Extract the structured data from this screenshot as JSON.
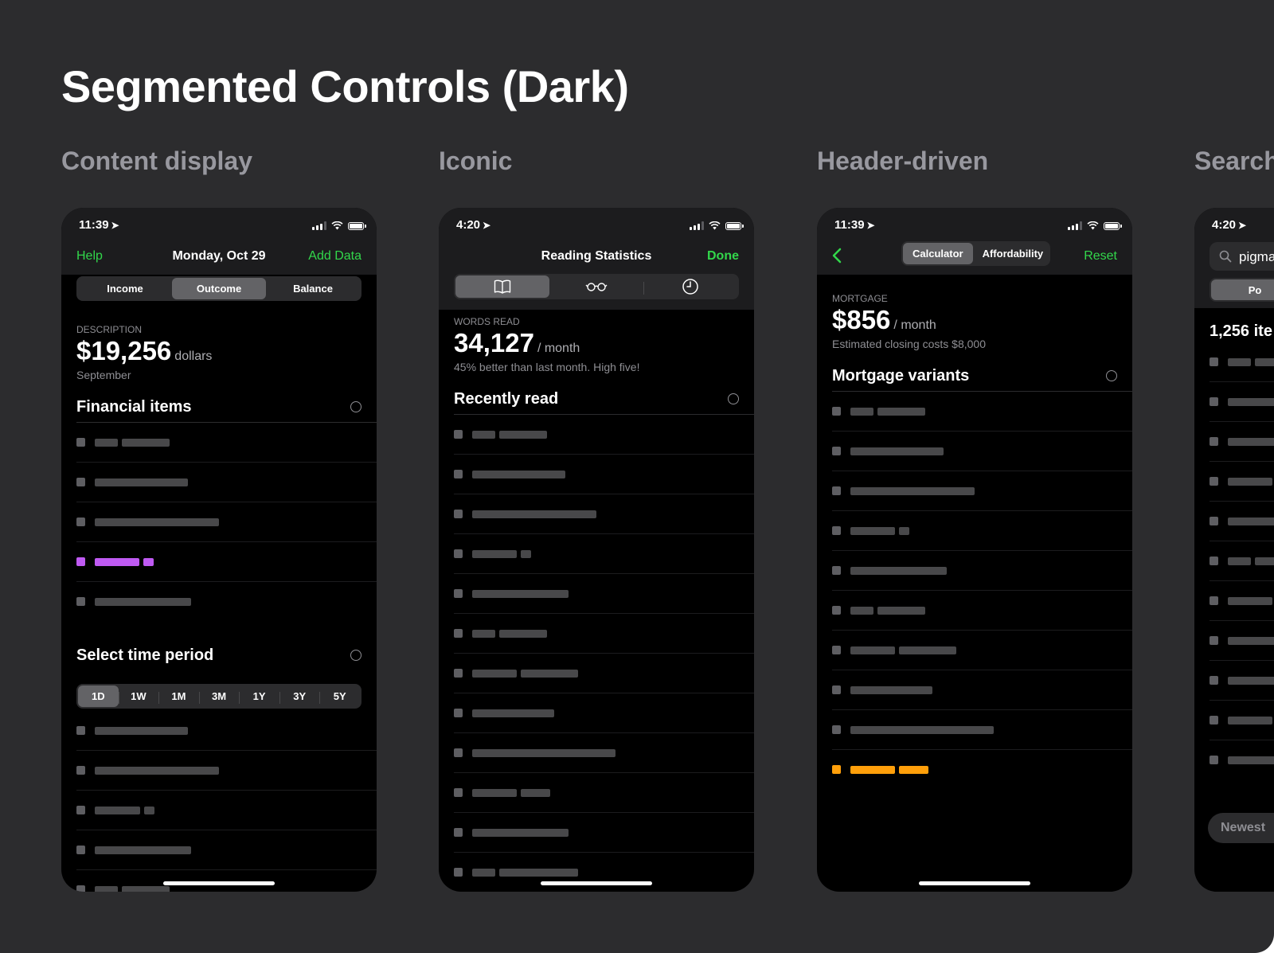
{
  "page": {
    "title": "Segmented Controls (Dark)"
  },
  "sections": [
    "Content display",
    "Iconic",
    "Header-driven",
    "Search"
  ],
  "phone1": {
    "time": "11:39",
    "nav": {
      "left": "Help",
      "title": "Monday, Oct 29",
      "right": "Add Data"
    },
    "segments": [
      "Income",
      "Outcome",
      "Balance"
    ],
    "selected_segment": "Outcome",
    "caption": "DESCRIPTION",
    "amount": "$19,256",
    "unit": "dollars",
    "sub": "September",
    "section1": "Financial items",
    "section2": "Select time period",
    "periods": [
      "1D",
      "1W",
      "1M",
      "3M",
      "1Y",
      "3Y",
      "5Y"
    ],
    "selected_period": "1D"
  },
  "phone2": {
    "time": "4:20",
    "nav": {
      "title": "Reading Statistics",
      "right": "Done"
    },
    "icon_segments": [
      "book-icon",
      "glasses-icon",
      "clock-icon"
    ],
    "selected_segment": "book-icon",
    "caption": "WORDS READ",
    "amount": "34,127",
    "unit": "/ month",
    "sub": "45% better than last month. High five!",
    "section1": "Recently read"
  },
  "phone3": {
    "time": "11:39",
    "segments": [
      "Calculator",
      "Affordability"
    ],
    "selected_segment": "Calculator",
    "nav": {
      "right": "Reset"
    },
    "caption": "MORTGAGE",
    "amount": "$856",
    "unit": "/ month",
    "sub": "Estimated closing costs $8,000",
    "section1": "Mortgage variants"
  },
  "phone4": {
    "time": "4:20",
    "search_value": "pigma",
    "segment_visible": "Po",
    "count_text": "1,256 ite",
    "sort_button": "Newest"
  },
  "colors": {
    "accent": "#32d74b",
    "highlight_purple": "#bf5af2",
    "highlight_orange": "#ff9f0a",
    "background": "#2c2c2e"
  }
}
